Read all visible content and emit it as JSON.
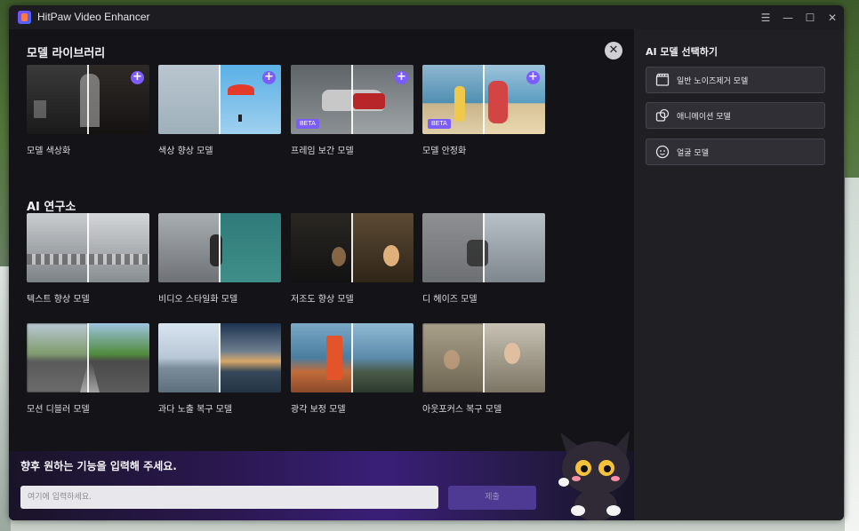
{
  "app": {
    "title": "HitPaw Video Enhancer"
  },
  "window_controls": {
    "menu": "☰",
    "minimize": "—",
    "maximize": "☐",
    "close": "✕"
  },
  "library": {
    "title": "모델 라이브러리",
    "close_glyph": "✕",
    "plus_glyph": "+",
    "cards": [
      {
        "label": "모델 색상화",
        "beta": false
      },
      {
        "label": "색상 향상 모델",
        "beta": false
      },
      {
        "label": "프레임 보간 모델",
        "beta": true
      },
      {
        "label": "모델 안정화",
        "beta": true
      }
    ],
    "beta_label": "BETA"
  },
  "lab": {
    "title": "AI 연구소",
    "cards": [
      {
        "label": "텍스트 향상 모델"
      },
      {
        "label": "비디오 스타일화 모델"
      },
      {
        "label": "저조도 향상 모델"
      },
      {
        "label": "디 헤이즈 모델"
      },
      {
        "label": "모션 디블러 모델"
      },
      {
        "label": "과다 노출 복구 모델"
      },
      {
        "label": "광각 보정 모델"
      },
      {
        "label": "아웃포커스 복구 모델"
      }
    ]
  },
  "footer": {
    "title": "향후 원하는 기능을 입력해 주세요.",
    "input_placeholder": "여기에 입력하세요.",
    "submit_label": "제출"
  },
  "side_panel": {
    "title": "AI 모델 선택하기",
    "buttons": [
      {
        "label": "일반 노이즈제거 모델",
        "icon": "clapperboard-icon"
      },
      {
        "label": "애니메이션 모델",
        "icon": "animation-icon"
      },
      {
        "label": "얼굴 모델",
        "icon": "face-icon"
      }
    ]
  },
  "colors": {
    "accent": "#7a5cff",
    "panel": "#1f1f24",
    "background": "#141418"
  }
}
